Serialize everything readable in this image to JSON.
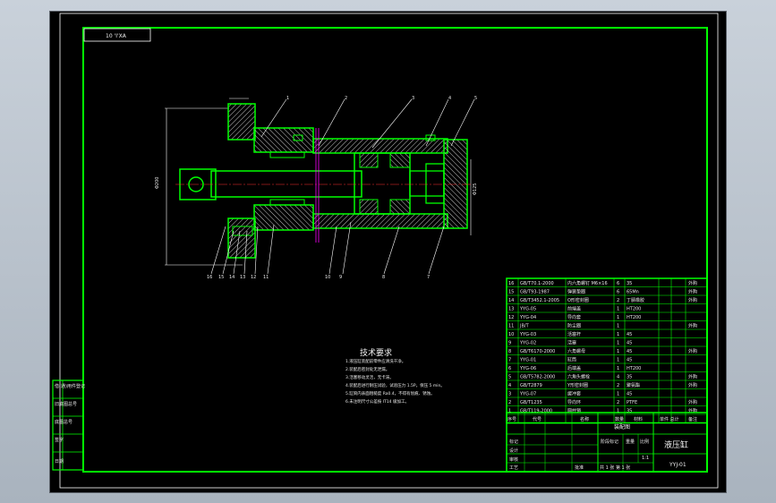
{
  "sheet_code": "10 'I'XA",
  "tech_requirements": {
    "title": "技术要求",
    "lines": [
      "1.液压缸装配前零件应清洗干净。",
      "2.装配后密封处无泄漏。",
      "3.活塞移动灵活，无卡滞。",
      "4.装配后进行耐压试验，试验压力 1.5P，保压 5 min。",
      "5.缸筒内表面粗糙度 Ra0.4，不得有划痕、锈蚀。",
      "6.未注明尺寸公差按 IT14 级加工。"
    ]
  },
  "callouts_top": [
    "1",
    "2",
    "3",
    "4",
    "5"
  ],
  "callouts_bottom": [
    "16",
    "15",
    "14",
    "13",
    "12",
    "11",
    "10",
    "9",
    "8",
    "7",
    "6"
  ],
  "bom_rows": [
    {
      "no": "16",
      "code": "GB/T70.1-2000",
      "name": "内六角螺钉 M6×16",
      "qty": "6",
      "material": "35",
      "note": "外购"
    },
    {
      "no": "15",
      "code": "GB/T93-1987",
      "name": "弹簧垫圈",
      "qty": "6",
      "material": "65Mn",
      "note": "外购"
    },
    {
      "no": "14",
      "code": "GB/T3452.1-2005",
      "name": "O形密封圈",
      "qty": "2",
      "material": "丁腈橡胶",
      "note": "外购"
    },
    {
      "no": "13",
      "code": "YYG-05",
      "name": "前端盖",
      "qty": "1",
      "material": "HT200",
      "note": ""
    },
    {
      "no": "12",
      "code": "YYG-04",
      "name": "导向套",
      "qty": "1",
      "material": "HT200",
      "note": ""
    },
    {
      "no": "11",
      "code": "JB/T",
      "name": "防尘圈",
      "qty": "1",
      "material": "",
      "note": "外购"
    },
    {
      "no": "10",
      "code": "YYG-03",
      "name": "活塞杆",
      "qty": "1",
      "material": "45",
      "note": ""
    },
    {
      "no": "9",
      "code": "YYG-02",
      "name": "活塞",
      "qty": "1",
      "material": "45",
      "note": ""
    },
    {
      "no": "8",
      "code": "GB/T6170-2000",
      "name": "六角螺母",
      "qty": "1",
      "material": "45",
      "note": "外购"
    },
    {
      "no": "7",
      "code": "YYG-01",
      "name": "缸筒",
      "qty": "1",
      "material": "45",
      "note": ""
    },
    {
      "no": "6",
      "code": "YYG-06",
      "name": "后端盖",
      "qty": "1",
      "material": "HT200",
      "note": ""
    },
    {
      "no": "5",
      "code": "GB/T5782-2000",
      "name": "六角头螺栓",
      "qty": "4",
      "material": "35",
      "note": "外购"
    },
    {
      "no": "4",
      "code": "GB/T2879",
      "name": "Y形密封圈",
      "qty": "2",
      "material": "聚氨酯",
      "note": "外购"
    },
    {
      "no": "3",
      "code": "YYG-07",
      "name": "缓冲套",
      "qty": "1",
      "material": "45",
      "note": ""
    },
    {
      "no": "2",
      "code": "GB/T1235",
      "name": "导向环",
      "qty": "2",
      "material": "PTFE",
      "note": "外购"
    },
    {
      "no": "1",
      "code": "GB/T119-2000",
      "name": "圆柱销",
      "qty": "1",
      "material": "35",
      "note": "外购"
    }
  ],
  "bom_header": {
    "no": "序号",
    "code": "代号",
    "name": "名称",
    "qty": "数量",
    "material": "材料",
    "weight": "单件 总计",
    "note": "备注"
  },
  "title_block": {
    "assembly_label": "装配图",
    "part_name": "液压缸",
    "drawing_no": "YYJ-01",
    "scale_label": "比例",
    "scale": "1:1",
    "sheet": "共 1 张 第 1 张",
    "mark_label": "标记",
    "designer": "设计",
    "checker": "审核",
    "process": "工艺",
    "approve": "批准",
    "stage": "阶段标记",
    "weight": "重量"
  },
  "left_strip": [
    "借(通)用件登记",
    "旧底图总号",
    "底图总号",
    "签字",
    "日期"
  ],
  "colors": {
    "frame": "#00ff00",
    "section": "#00dd00",
    "hatch": "#ffffff",
    "centerline": "#ff3030",
    "cutline": "#ff00ff",
    "text": "#e8e8e8",
    "background": "#000000"
  }
}
